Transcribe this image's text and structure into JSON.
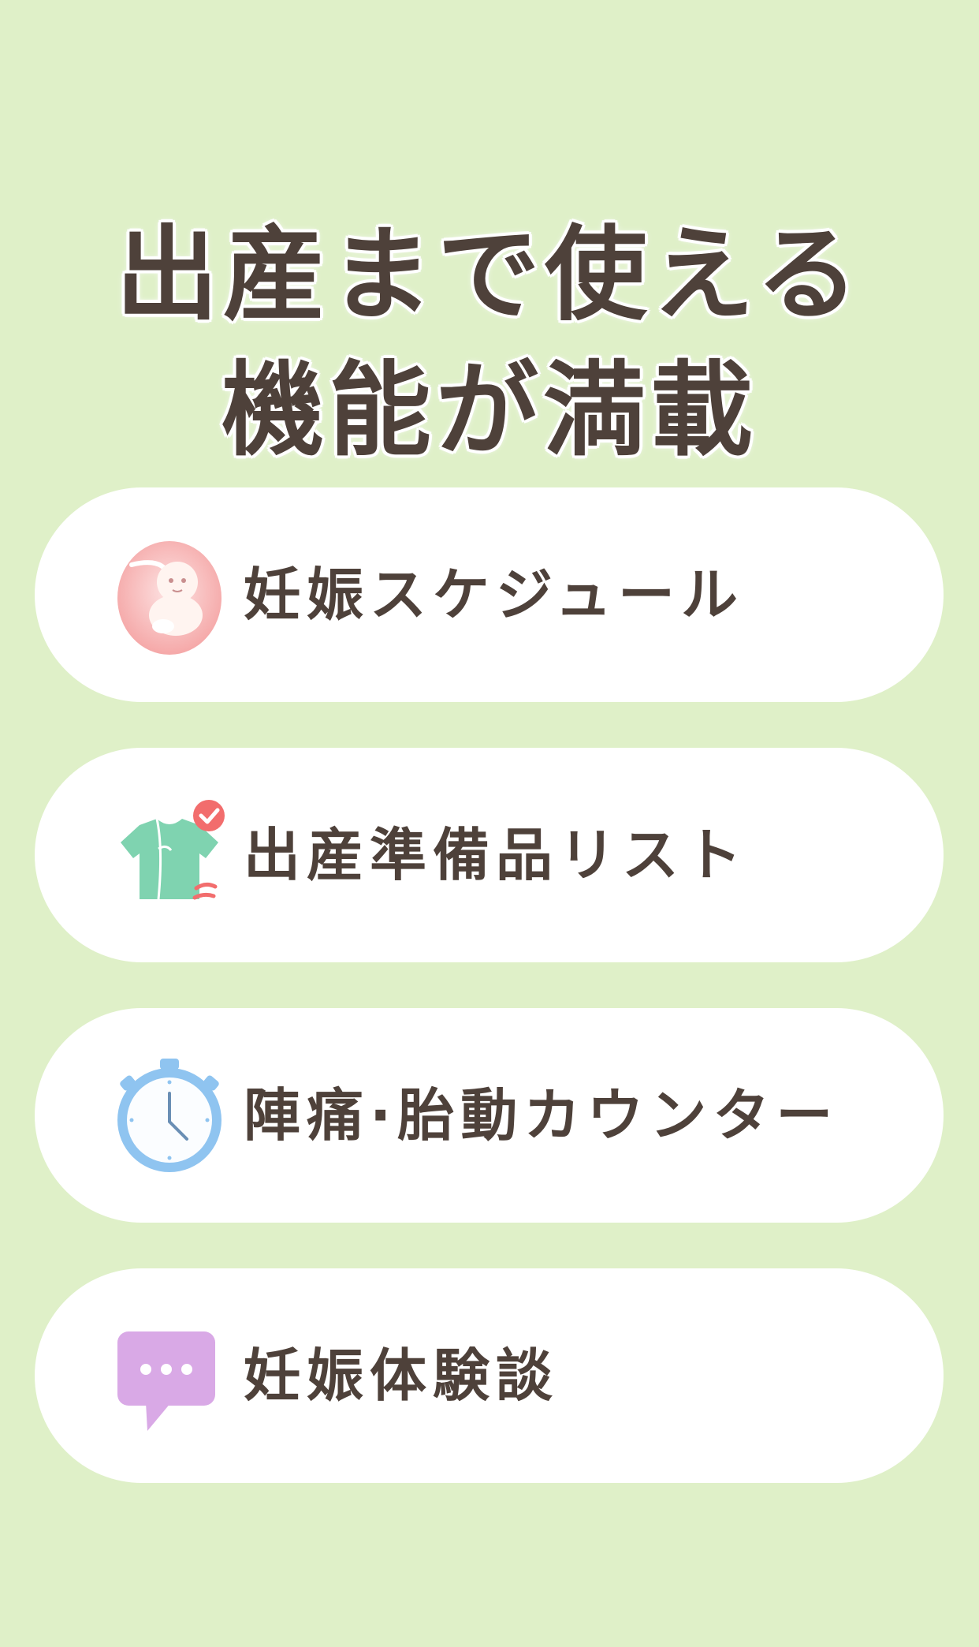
{
  "headline": {
    "line1": "出産まで使える",
    "line2": "機能が満載"
  },
  "features": [
    {
      "label": "妊娠スケジュール",
      "icon": "fetus-icon"
    },
    {
      "label": "出産準備品リスト",
      "icon": "baby-clothes-check-icon"
    },
    {
      "label": "陣痛·胎動カウンター",
      "icon": "stopwatch-icon"
    },
    {
      "label": "妊娠体験談",
      "icon": "chat-bubble-icon"
    }
  ],
  "colors": {
    "background": "#dff0c8",
    "card": "#ffffff",
    "text": "#4e413a",
    "fetus_pink": "#f7b7b7",
    "clothes_green": "#7fd3b0",
    "check_red": "#f26d6d",
    "clock_blue": "#8fc4f0",
    "bubble_purple": "#d9a9e6"
  }
}
